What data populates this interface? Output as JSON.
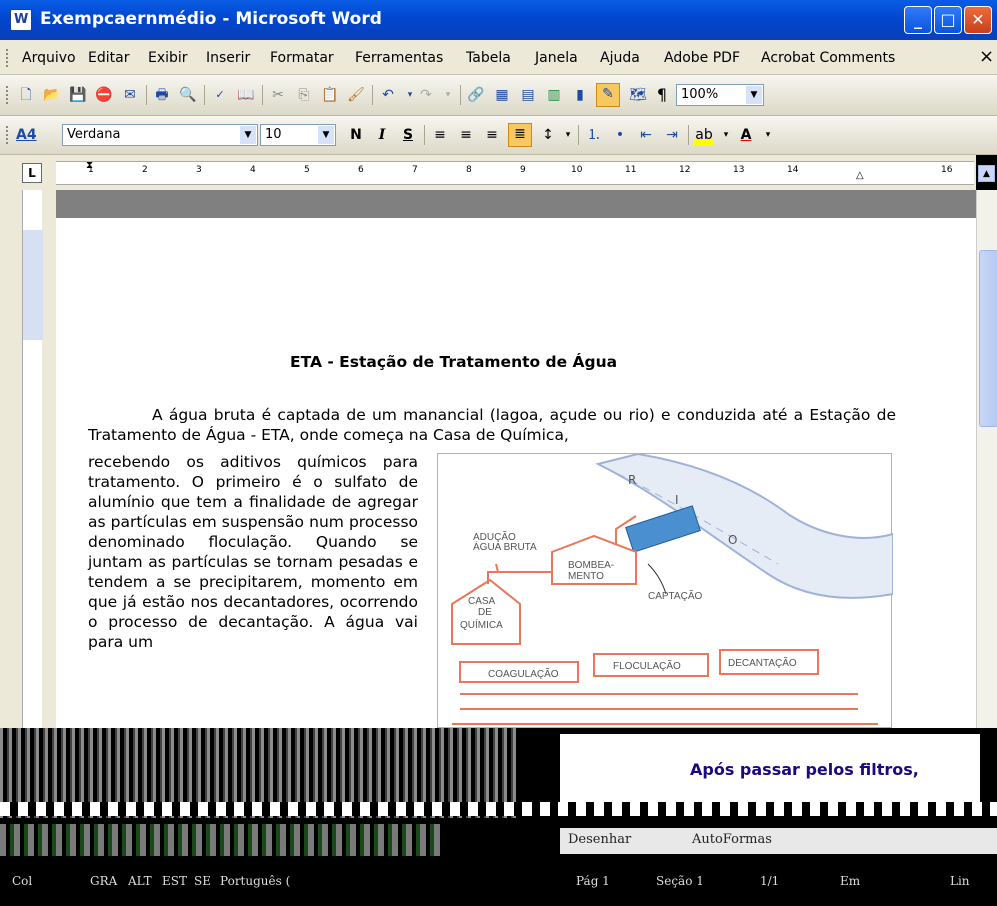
{
  "window": {
    "title": "Exempcaernmédio - Microsoft Word",
    "app_icon": "word-doc-icon",
    "buttons": {
      "minimize": "_",
      "maximize": "□",
      "close": "✕"
    }
  },
  "menu": {
    "items": [
      "Arquivo",
      "Editar",
      "Exibir",
      "Inserir",
      "Formatar",
      "Ferramentas",
      "Tabela",
      "Janela",
      "Ajuda",
      "Adobe PDF",
      "Acrobat Comments"
    ],
    "close_glyph": "×"
  },
  "standard_toolbar": {
    "zoom": "100%",
    "pilcrow": "¶"
  },
  "format_toolbar": {
    "style_icon": "A4",
    "font": "Verdana",
    "size": "10",
    "bold": "N",
    "italic": "I",
    "underline": "S"
  },
  "ruler": {
    "tab_selector": "L",
    "numbers": [
      "1",
      "2",
      "3",
      "4",
      "5",
      "6",
      "7",
      "8",
      "9",
      "10",
      "11",
      "12",
      "13",
      "14",
      "16"
    ]
  },
  "document": {
    "title": "ETA - Estação de Tratamento de Água",
    "para1": "A água bruta é captada de um manancial (lagoa, açude ou rio) e conduzida até a Estação de Tratamento de Água - ETA, onde começa na Casa de Química,",
    "para2": "recebendo os aditivos químicos para tratamento. O primeiro é o sulfato de alumínio que tem a finalidade de agregar as partículas em suspensão num processo denominado floculação. Quando se juntam as partículas se tornam pesadas e tendem a se precipitarem, momento em que já estão nos decantadores, ocorrendo o processo de decantação. A água vai para um"
  },
  "figure": {
    "labels": {
      "rio_r": "R",
      "rio_i": "I",
      "rio_o": "O",
      "aducao": "ADUÇÃO",
      "agua_bruta": "ÁGUA BRUTA",
      "bombea": "BOMBEA-",
      "mento": "MENTO",
      "captacao": "CAPTAÇÃO",
      "casa": "CASA",
      "de": "DE",
      "quimica": "QUÍMICA",
      "coagulacao": "COAGULAÇÃO",
      "floculacao": "FLOCULAÇÃO",
      "decantacao": "DECANTAÇÃO"
    },
    "colors": {
      "line": "#e8785a",
      "river": "#9fb3d8",
      "station": "#4a8fd0"
    }
  },
  "glitched": {
    "snippet1": "Após passar pelos filtros,",
    "draw_menu": "Desenhar",
    "autoshapes": "AutoFormas",
    "status": {
      "col": "Col",
      "gra": "GRA",
      "alt": "ALT",
      "est": "EST",
      "se": "SE",
      "lang": "Português (",
      "pag": "Pág 1",
      "secao": "Seção 1",
      "pages": "1/1",
      "em": "Em",
      "lin": "Lin"
    }
  }
}
